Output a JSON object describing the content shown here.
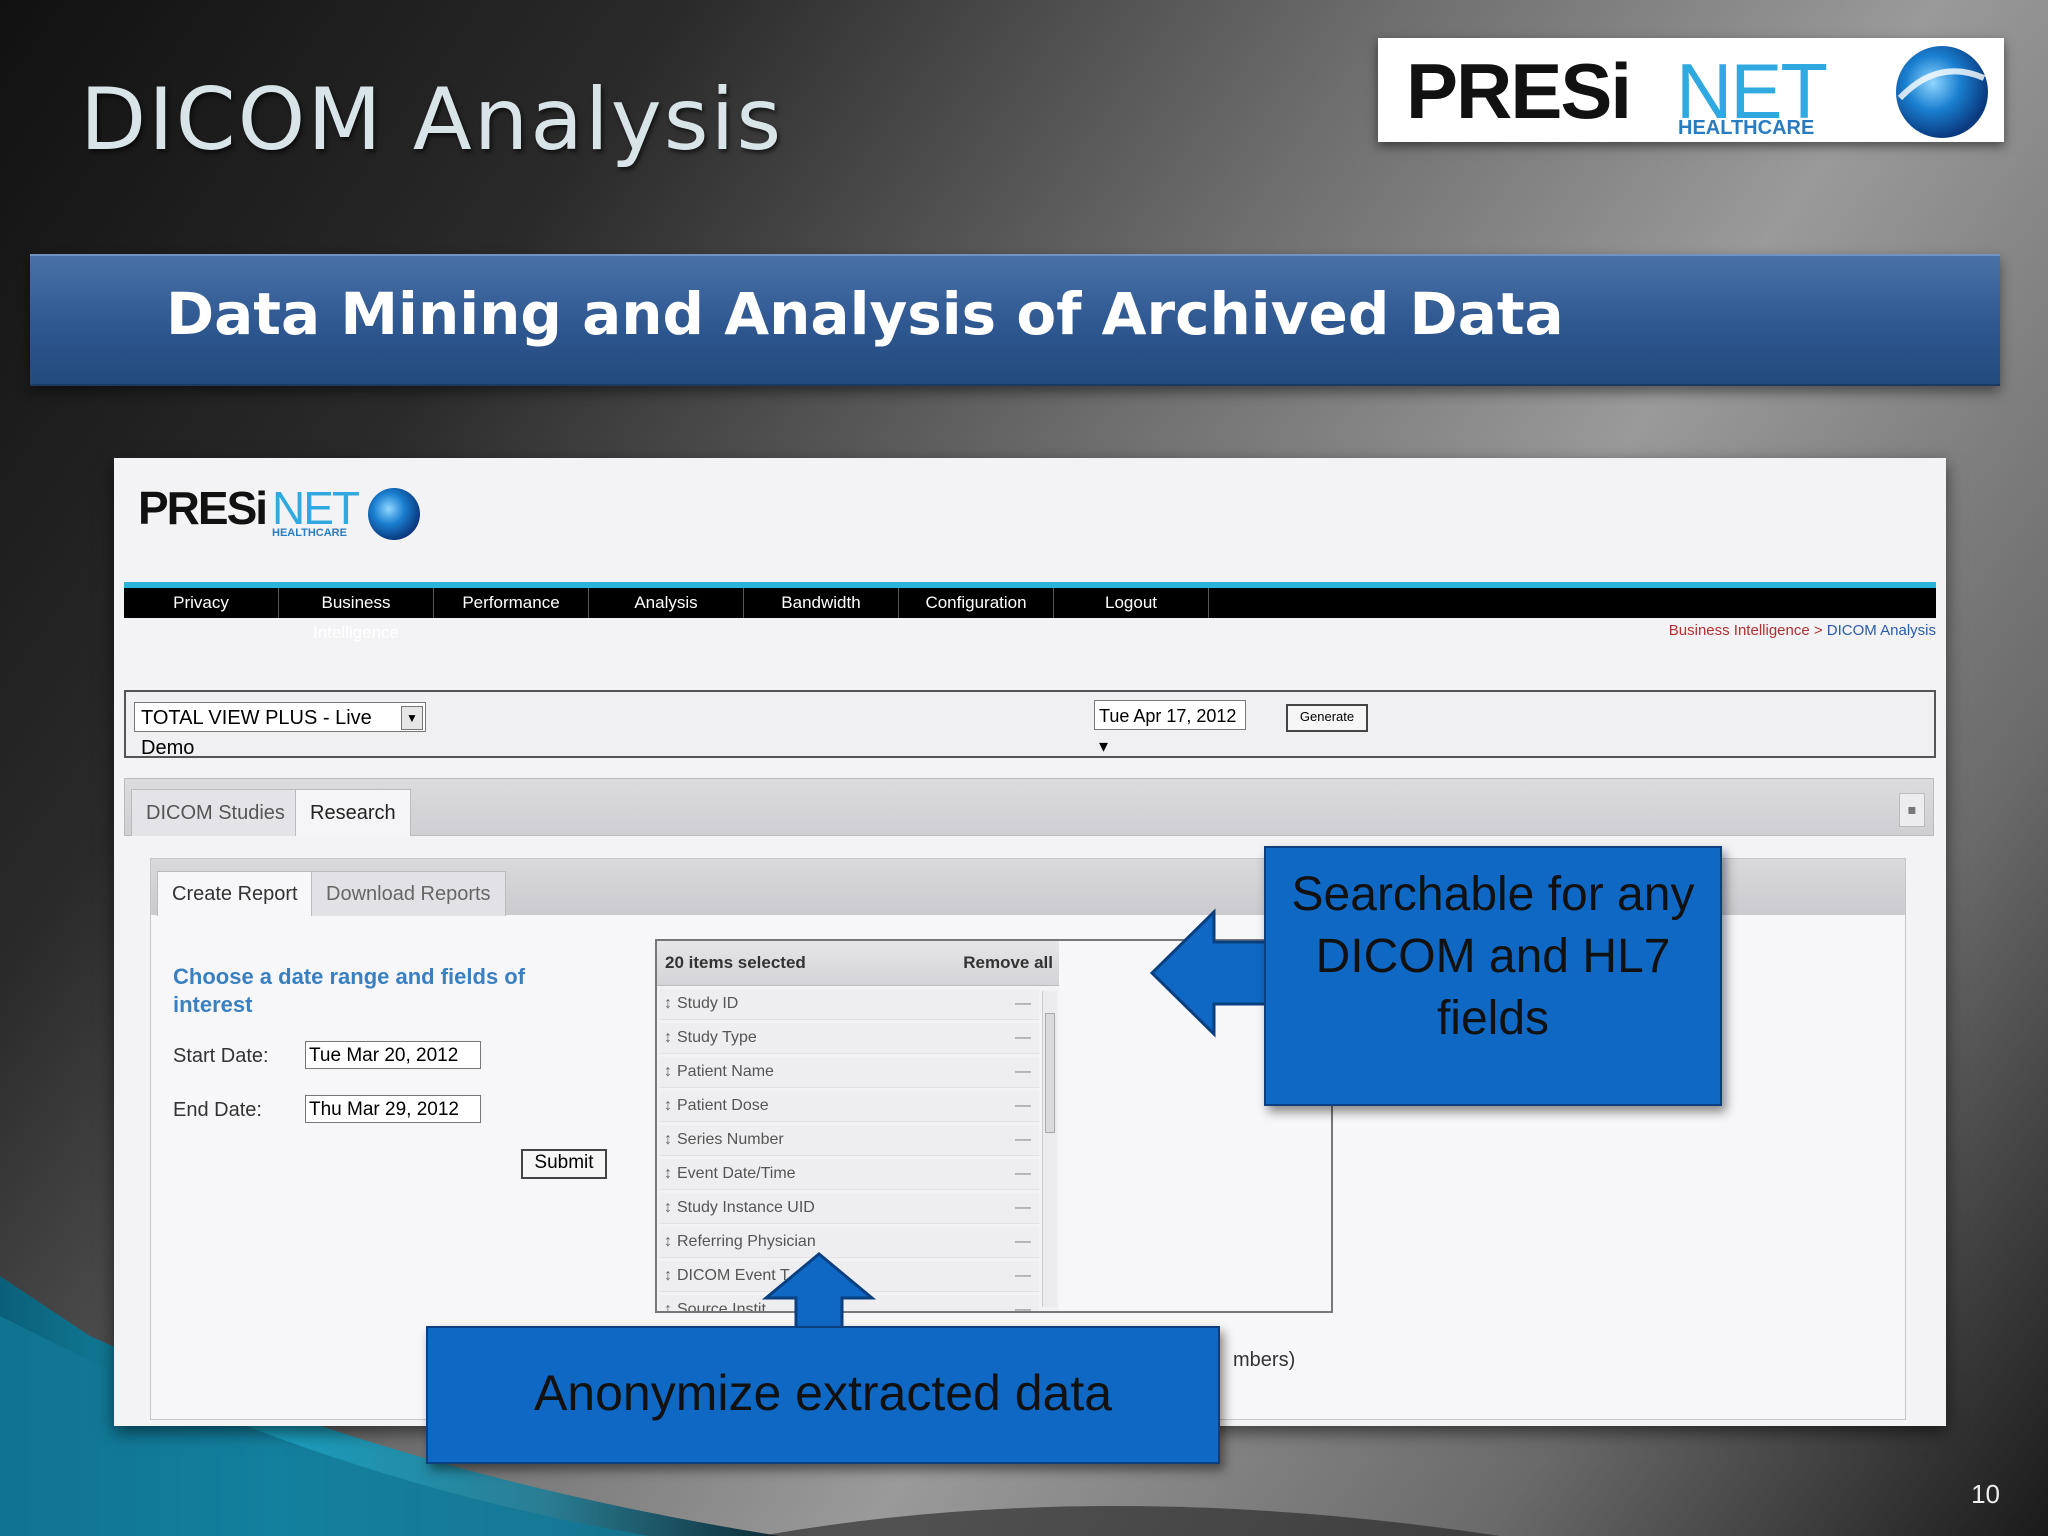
{
  "slide": {
    "title": "DICOM Analysis",
    "banner": "Data Mining and Analysis of Archived Data",
    "page_number": "10"
  },
  "logo": {
    "presi": "PRESi",
    "net": "NET",
    "healthcare": "HEALTHCARE"
  },
  "app": {
    "logo_presi": "PRESi",
    "logo_net": "NET",
    "logo_healthcare": "HEALTHCARE",
    "nav": [
      "Privacy",
      "Business Intelligence",
      "Performance",
      "Analysis",
      "Bandwidth",
      "Configuration",
      "Logout"
    ],
    "breadcrumb_parent": "Business Intelligence",
    "breadcrumb_sep": " > ",
    "breadcrumb_current": "DICOM Analysis",
    "site_select": "TOTAL VIEW PLUS - Live Demo",
    "date_value": "Tue Apr 17, 2012",
    "generate_label": "Generate",
    "tabs": [
      "DICOM Studies",
      "Research"
    ],
    "subtabs": [
      "Create Report",
      "Download Reports"
    ],
    "choose_label": "Choose a date range and fields of interest",
    "start_label": "Start Date:",
    "start_value": "Tue Mar 20, 2012",
    "end_label": "End Date:",
    "end_value": "Thu Mar 29, 2012",
    "submit_label": "Submit",
    "list_count": "20 items selected",
    "remove_all": "Remove all",
    "list_items": [
      "Study ID",
      "Study Type",
      "Patient Name",
      "Patient Dose",
      "Series Number",
      "Event Date/Time",
      "Study Instance UID",
      "Referring Physician",
      "DICOM Event T",
      "Source Instit"
    ],
    "cut_text": "mbers)"
  },
  "callouts": {
    "searchable": "Searchable for any DICOM  and HL7 fields",
    "anonymize": "Anonymize extracted data"
  },
  "colors": {
    "banner": "#2e5790",
    "callout": "#0f69c4",
    "nav_accent": "#2bb3d9",
    "choose_label": "#3a7fc0"
  }
}
